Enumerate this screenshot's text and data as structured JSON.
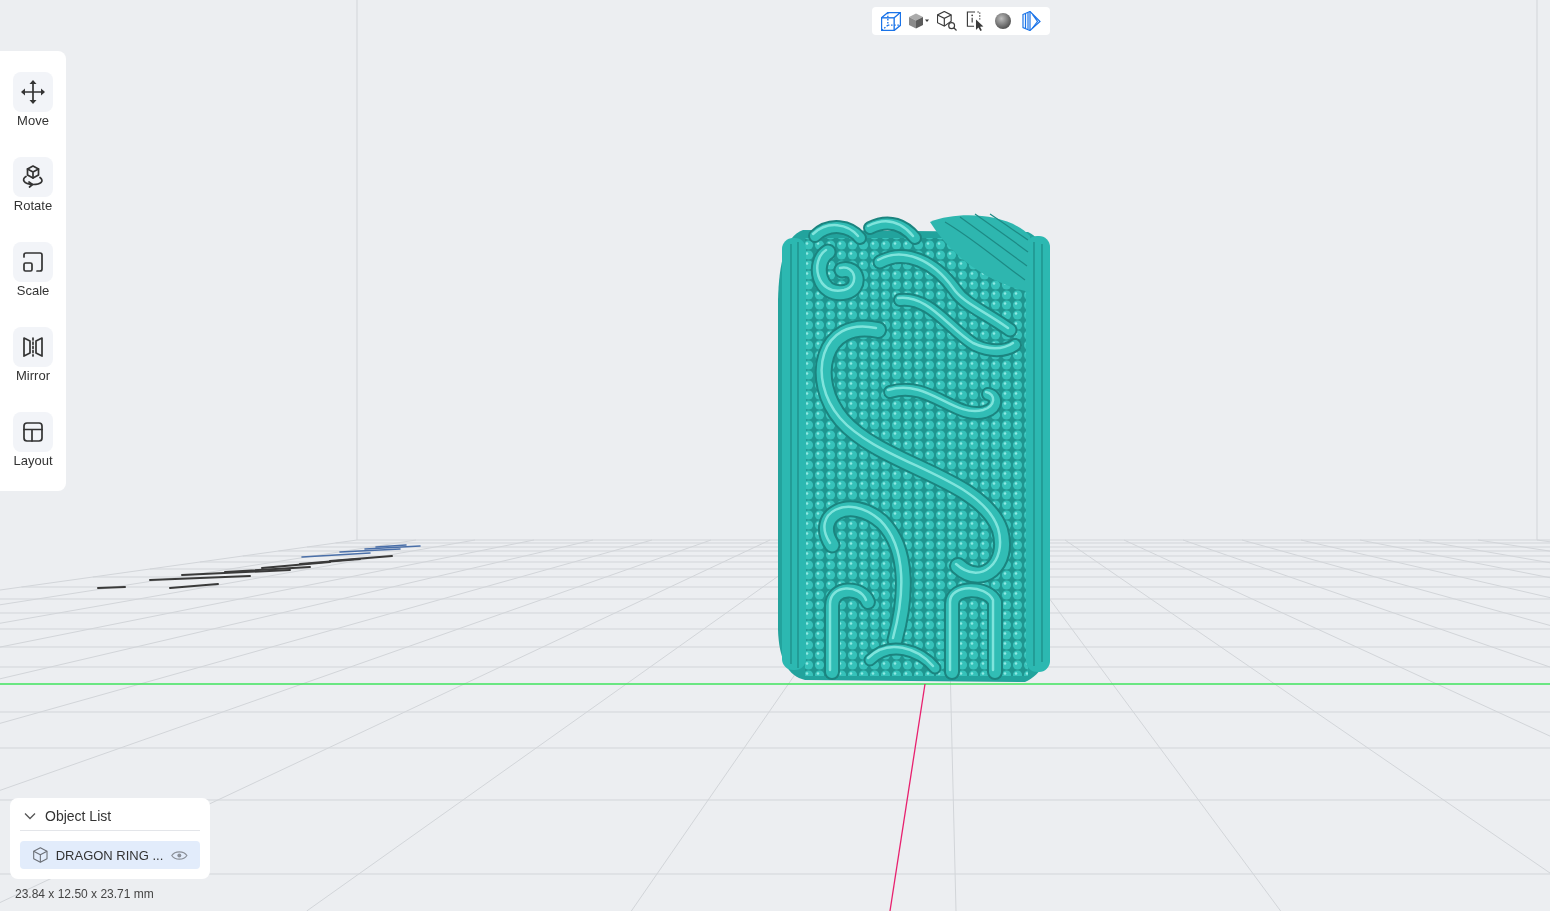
{
  "view_toolbar": {
    "buttons": [
      {
        "kind": "wireframe-cube",
        "active": true
      },
      {
        "kind": "solid-cube",
        "active": false
      },
      {
        "kind": "cube-zoom",
        "active": false
      },
      {
        "kind": "cursor-select",
        "active": false
      },
      {
        "kind": "sphere",
        "active": false
      },
      {
        "kind": "striped-prism",
        "active": true
      }
    ]
  },
  "tool_sidebar": {
    "tools": [
      {
        "kind": "move",
        "label": "Move",
        "selected": false
      },
      {
        "kind": "rotate",
        "label": "Rotate",
        "selected": false
      },
      {
        "kind": "scale",
        "label": "Scale",
        "selected": false
      },
      {
        "kind": "mirror",
        "label": "Mirror",
        "selected": false
      },
      {
        "kind": "layout",
        "label": "Layout",
        "selected": false
      }
    ]
  },
  "object_list": {
    "title": "Object List",
    "expanded": true,
    "items": [
      {
        "name": "DRAGON RING ...",
        "selected": true,
        "visible": true
      }
    ]
  },
  "dimensions": "23.84 x 12.50 x 23.71 mm"
}
